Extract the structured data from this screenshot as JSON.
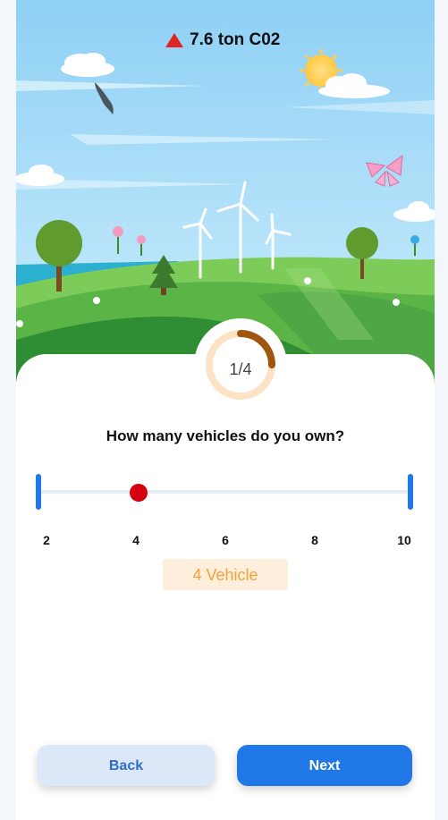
{
  "header": {
    "co2_value": "7.6 ton C02",
    "trend_icon": "triangle-up-icon",
    "trend_color": "#e02424"
  },
  "progress": {
    "label": "1/4",
    "fraction": 0.25
  },
  "question": {
    "text": "How many vehicles do you own?"
  },
  "slider": {
    "min": 2,
    "max": 10,
    "value": 4,
    "ticks": [
      "2",
      "4",
      "6",
      "8",
      "10"
    ]
  },
  "selected_value_label": "4 Vehicle",
  "buttons": {
    "back_label": "Back",
    "next_label": "Next"
  },
  "colors": {
    "primary": "#1f78e6",
    "slider_thumb": "#d6000f",
    "progress_arc": "#a0560f",
    "progress_track": "#fde2c6",
    "pill_bg": "#fdefdc",
    "pill_text": "#f2a13b"
  }
}
